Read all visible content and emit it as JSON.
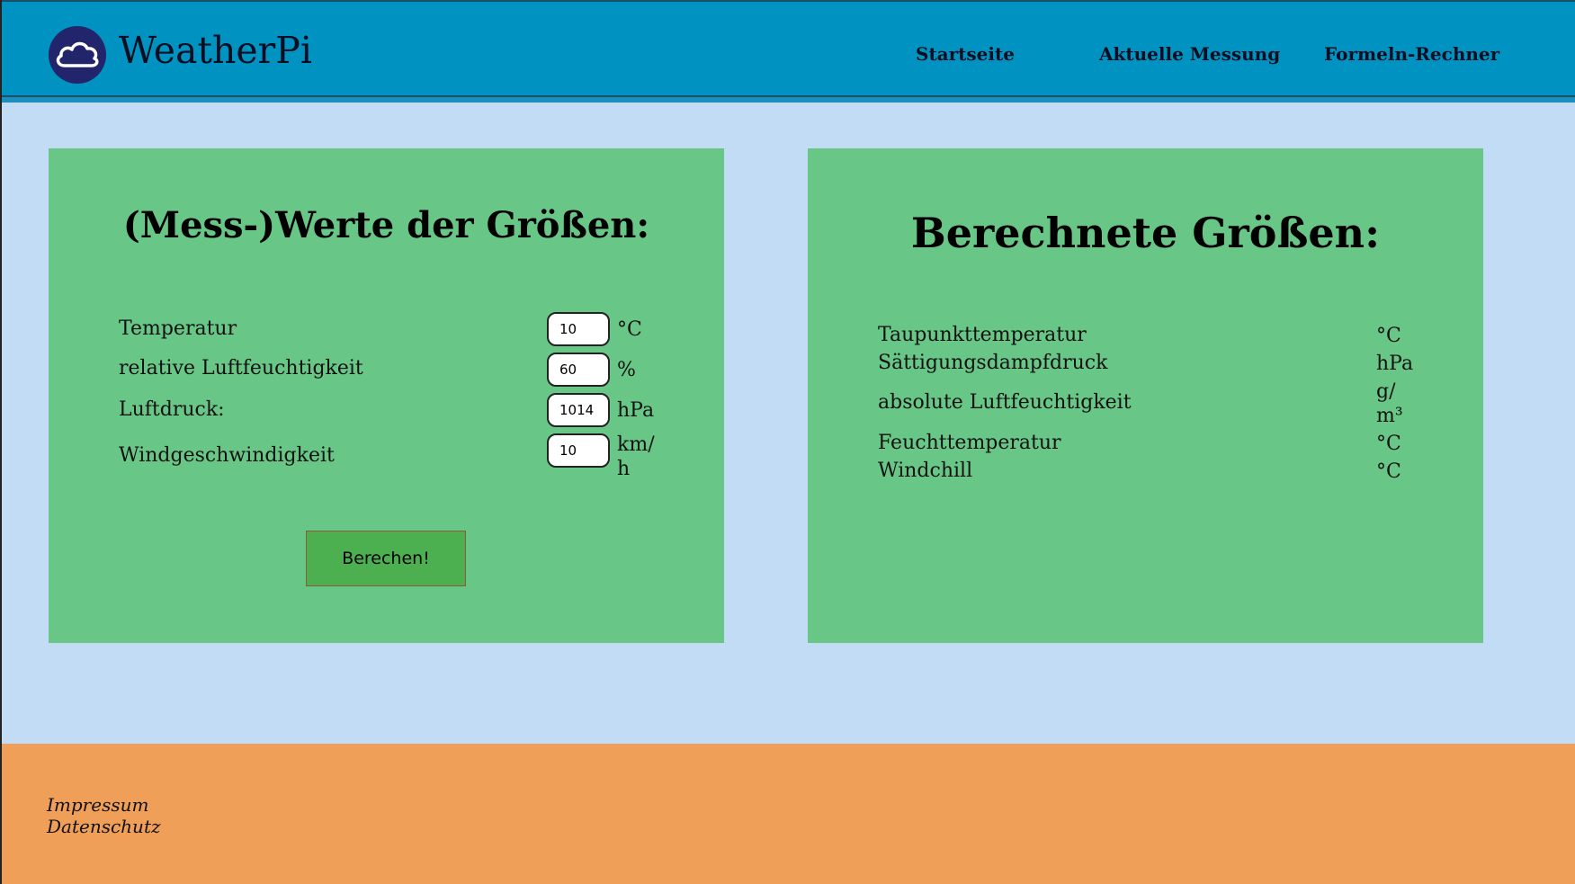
{
  "header": {
    "brand": "WeatherPi",
    "logo_icon": "cloud-icon",
    "nav": [
      {
        "label": "Startseite"
      },
      {
        "label": "Aktuelle Messung"
      },
      {
        "label": "Formeln-Rechner"
      }
    ]
  },
  "inputs_panel": {
    "title": "(Mess-)Werte der Größen:",
    "rows": [
      {
        "label": "Temperatur",
        "value": "10",
        "unit": "°C"
      },
      {
        "label": "relative Luftfeuchtigkeit",
        "value": "60",
        "unit": "%"
      },
      {
        "label": "Luftdruck:",
        "value": "1014",
        "unit": "hPa"
      },
      {
        "label": "Windgeschwindigkeit",
        "value": "10",
        "unit": "km/h"
      }
    ],
    "button_label": "Berechen!"
  },
  "results_panel": {
    "title": "Berechnete Größen:",
    "rows": [
      {
        "label": "Taupunkttemperatur",
        "unit": "°C"
      },
      {
        "label": "Sättigungsdampfdruck",
        "unit": "hPa"
      },
      {
        "label": "absolute Luftfeuchtigkeit",
        "unit": "g/m³"
      },
      {
        "label": "Feuchttemperatur",
        "unit": "°C"
      },
      {
        "label": "Windchill",
        "unit": "°C"
      }
    ]
  },
  "footer": {
    "links": [
      {
        "label": "Impressum"
      },
      {
        "label": "Datenschutz"
      }
    ]
  },
  "colors": {
    "header": "#0092c0",
    "page_bg": "#c2dcf6",
    "panel": "#68c687",
    "button": "#4caf50",
    "footer": "#f09f58",
    "logo": "#22256b"
  }
}
